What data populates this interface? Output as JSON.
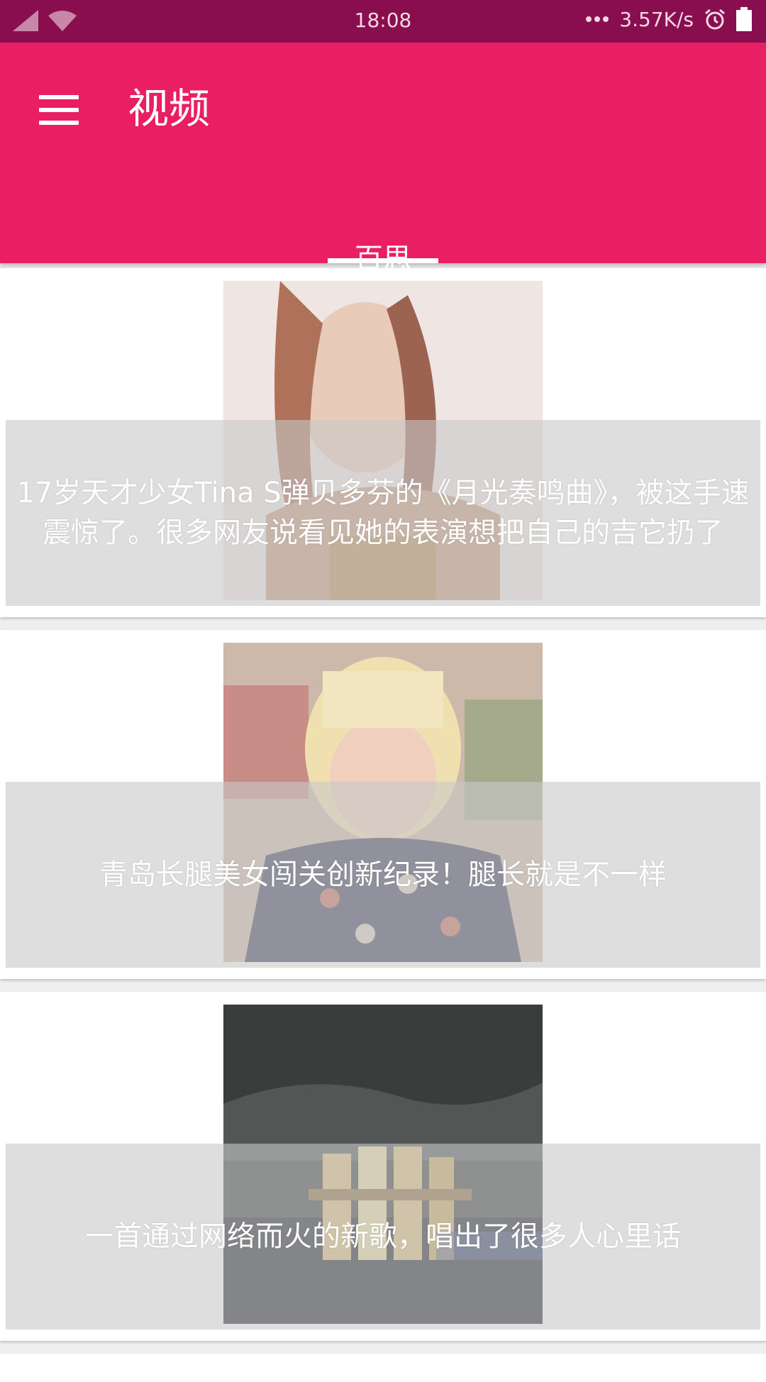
{
  "status_bar": {
    "time": "18:08",
    "network_speed": "3.57K/s"
  },
  "app_bar": {
    "title": "视频",
    "tabs": [
      {
        "label": "百思",
        "selected": true
      }
    ]
  },
  "feed": {
    "items": [
      {
        "caption": "17岁天才少女Tina S弹贝多芬的《月光奏鸣曲》，被这手速震惊了。很多网友说看见她的表演想把自己的吉它扔了"
      },
      {
        "caption": "青岛长腿美女闯关创新纪录！腿长就是不一样"
      },
      {
        "caption": "一首通过网络而火的新歌，唱出了很多人心里话"
      }
    ]
  },
  "colors": {
    "primary": "#e91e63",
    "primary_dark": "#880e4f"
  }
}
